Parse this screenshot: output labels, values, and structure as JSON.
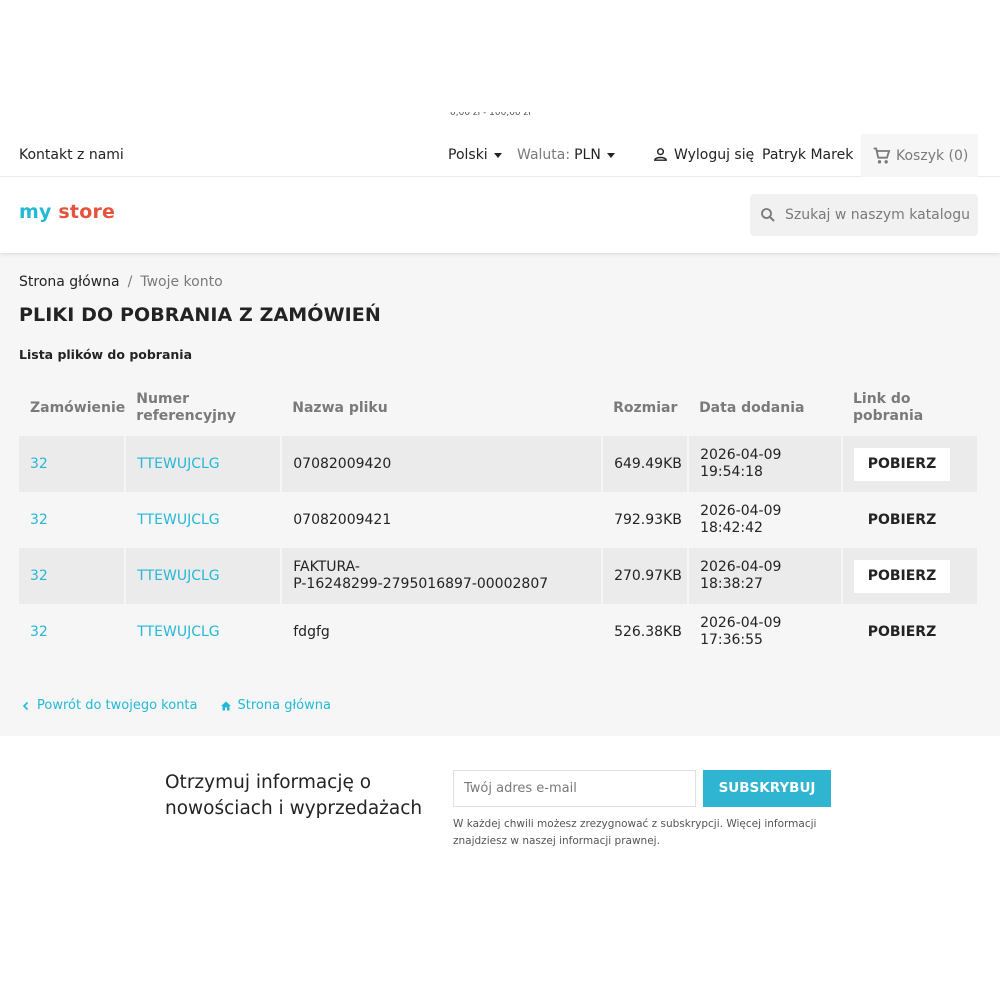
{
  "top_clip": "0,00 zł - 100,00 zł",
  "nav": {
    "contact": "Kontakt z nami",
    "language": "Polski",
    "currency_label": "Waluta:",
    "currency_value": "PLN",
    "logout": "Wyloguj się",
    "user": "Patryk Marek",
    "cart": "Koszyk (0)"
  },
  "header": {
    "logo": {
      "part1": "my",
      "part2": "store"
    },
    "search_placeholder": "Szukaj w naszym katalogu"
  },
  "breadcrumb": {
    "home": "Strona główna",
    "separator": "/",
    "current": "Twoje konto"
  },
  "page": {
    "title": "PLIKI DO POBRANIA Z ZAMÓWIEŃ",
    "subtitle": "Lista plików do pobrania"
  },
  "table": {
    "headers": {
      "order": "Zamówienie",
      "reference_1": "Numer",
      "reference_2": "referencyjny",
      "filename": "Nazwa pliku",
      "size": "Rozmiar",
      "date": "Data dodania",
      "link_1": "Link do",
      "link_2": "pobrania"
    },
    "rows": [
      {
        "order": "32",
        "reference": "TTEWUJCLG",
        "filename_1": "07082009420",
        "filename_2": "",
        "size": "649.49KB",
        "date": "2026-04-09",
        "time": "19:54:18",
        "action": "POBIERZ"
      },
      {
        "order": "32",
        "reference": "TTEWUJCLG",
        "filename_1": "07082009421",
        "filename_2": "",
        "size": "792.93KB",
        "date": "2026-04-09",
        "time": "18:42:42",
        "action": "POBIERZ"
      },
      {
        "order": "32",
        "reference": "TTEWUJCLG",
        "filename_1": "FAKTURA-",
        "filename_2": "P-16248299-2795016897-00002807",
        "size": "270.97KB",
        "date": "2026-04-09",
        "time": "18:38:27",
        "action": "POBIERZ"
      },
      {
        "order": "32",
        "reference": "TTEWUJCLG",
        "filename_1": "fdgfg",
        "filename_2": "",
        "size": "526.38KB",
        "date": "2026-04-09",
        "time": "17:36:55",
        "action": "POBIERZ"
      }
    ]
  },
  "footer_links": {
    "back": "Powrót do twojego konta",
    "home": "Strona główna"
  },
  "newsletter": {
    "title": "Otrzymuj informację o nowościach i wyprzedażach",
    "email_placeholder": "Twój adres e-mail",
    "button": "SUBSKRYBUJ",
    "note": "W każdej chwili możesz zrezygnować z subskrypcji. Więcej informacji znajdziesz w naszej informacji prawnej."
  },
  "colors": {
    "accent": "#24b9d7",
    "button": "#2fb5d2",
    "text": "#232323",
    "muted": "#7a7a7a",
    "bg": "#f6f6f6"
  }
}
